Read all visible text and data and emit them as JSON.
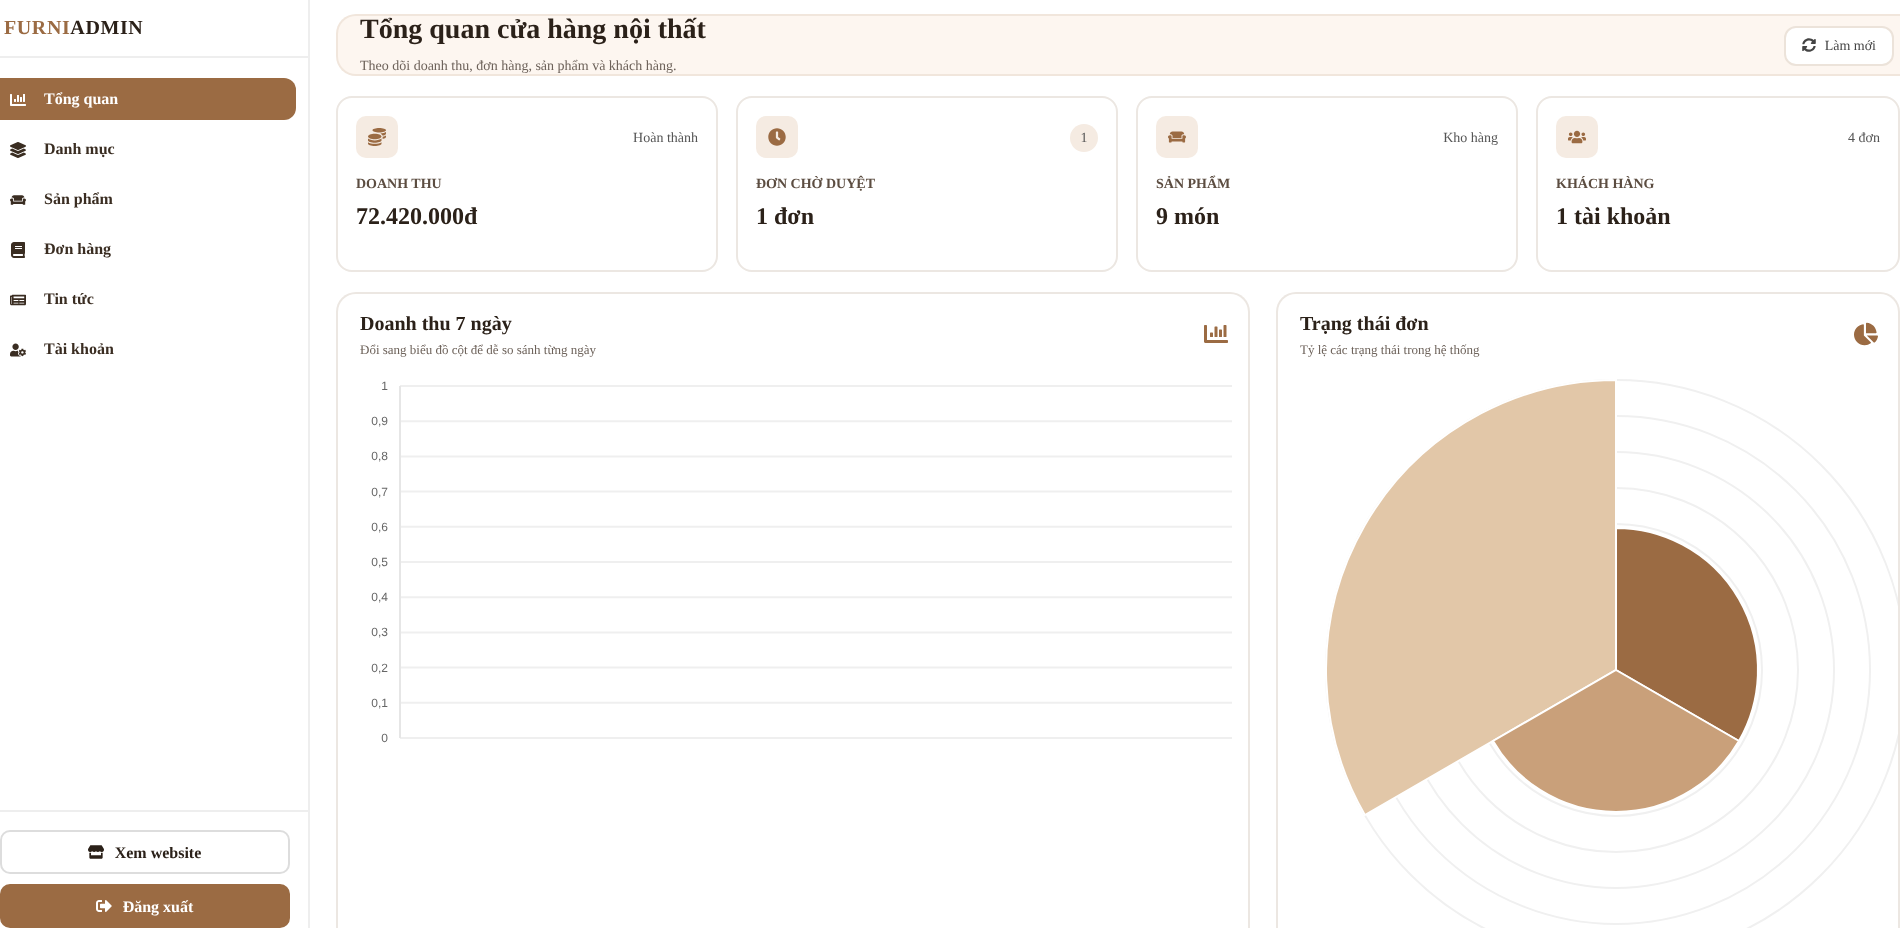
{
  "brand": {
    "part_1": "FURNI",
    "part_2": "ADMIN"
  },
  "sidebar": {
    "items": [
      {
        "label": "Tổng quan",
        "selected": true
      },
      {
        "label": "Danh mục",
        "selected": false
      },
      {
        "label": "Sản phẩm",
        "selected": false
      },
      {
        "label": "Đơn hàng",
        "selected": false
      },
      {
        "label": "Tin tức",
        "selected": false
      },
      {
        "label": "Tài khoản",
        "selected": false
      }
    ],
    "buttons": [
      {
        "label": "Xem website",
        "kind": "outline"
      },
      {
        "label": "Đăng xuất",
        "kind": "filled"
      }
    ]
  },
  "header": {
    "title": "Tổng quan cửa hàng nội thất",
    "subtitle": "Theo dõi doanh thu, đơn hàng, sản phẩm và khách hàng.",
    "button": "Làm mới"
  },
  "stats": [
    {
      "tag": "Hoàn thành",
      "kind": "text",
      "label": "DOANH THU",
      "value": "72.420.000đ"
    },
    {
      "tag": "1",
      "kind": "pill",
      "label": "ĐƠN CHỜ DUYỆT",
      "value": "1 đơn"
    },
    {
      "tag": "Kho hàng",
      "kind": "text",
      "label": "SẢN PHẨM",
      "value": "9 món"
    },
    {
      "tag": "4 đơn",
      "kind": "text",
      "label": "KHÁCH HÀNG",
      "value": "1 tài khoản"
    }
  ],
  "revenue_panel": {
    "title": "Doanh thu 7 ngày",
    "subtitle": "Đổi sang biểu đồ cột để dễ so sánh từng ngày",
    "axis_labels": [
      "1",
      "0,9",
      "0,8",
      "0,7",
      "0,6",
      "0,5",
      "0,4",
      "0,3",
      "0,2",
      "0,1",
      "0"
    ]
  },
  "status_panel": {
    "title": "Trạng thái đơn",
    "subtitle": "Tỷ lệ các trạng thái trong hệ thống"
  }
}
